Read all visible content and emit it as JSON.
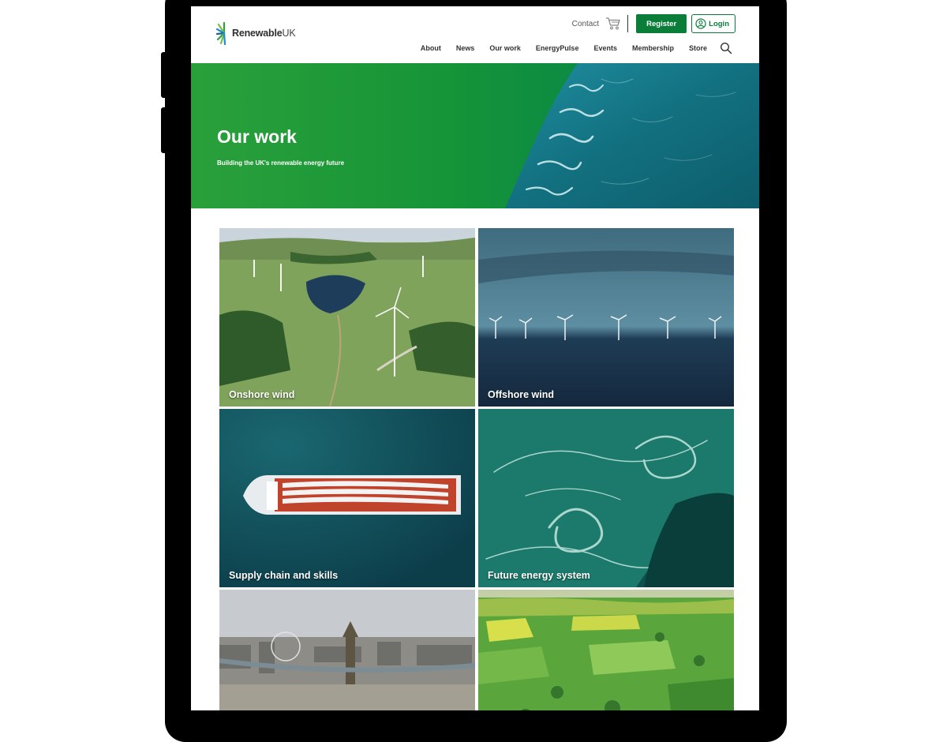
{
  "brand": {
    "name_bold": "Renewable",
    "name_thin": "UK",
    "accent": "#0a7d39"
  },
  "utility": {
    "contact": "Contact",
    "cart_icon": "cart-icon",
    "register": "Register",
    "login": "Login",
    "login_icon": "user-circle-icon"
  },
  "nav": {
    "items": [
      "About",
      "News",
      "Our work",
      "EnergyPulse",
      "Events",
      "Membership",
      "Store"
    ],
    "search_icon": "search-icon"
  },
  "hero": {
    "title": "Our work",
    "subtitle": "Building the UK's renewable energy future"
  },
  "tiles": [
    {
      "label": "Onshore wind"
    },
    {
      "label": "Offshore wind"
    },
    {
      "label": "Supply chain and skills"
    },
    {
      "label": "Future energy system"
    },
    {
      "label": ""
    },
    {
      "label": ""
    }
  ]
}
